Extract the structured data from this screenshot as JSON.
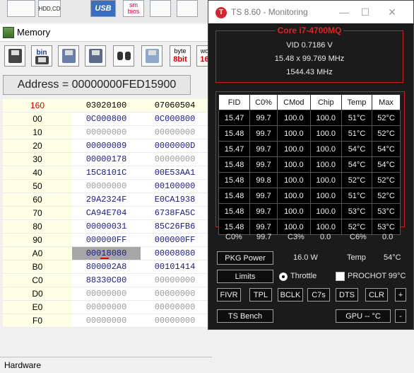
{
  "background_toolbar": {
    "items": [
      "HDD,CD",
      "USB",
      "sm bios"
    ]
  },
  "memory_window": {
    "title": "Memory",
    "toolbar": {
      "bin_label": "bin",
      "byte_label_top": "byte",
      "byte_label_bottom": "8bit",
      "word_label_top": "wo",
      "word_label_bottom": "16"
    },
    "address_display": "Address = 00000000FED15900",
    "grid": {
      "header": [
        "160",
        "03020100",
        "07060504"
      ],
      "rows": [
        {
          "label": "00",
          "c1": "0C000800",
          "c2": "0C000800"
        },
        {
          "label": "10",
          "c1": "00000000",
          "c2": "00000000"
        },
        {
          "label": "20",
          "c1": "00000009",
          "c2": "0000000D"
        },
        {
          "label": "30",
          "c1": "00000178",
          "c2": "00000000"
        },
        {
          "label": "40",
          "c1": "15C8101C",
          "c2": "00E53AA1"
        },
        {
          "label": "50",
          "c1": "00000000",
          "c2": "00100000"
        },
        {
          "label": "60",
          "c1": "29A2324F",
          "c2": "E0CA1938"
        },
        {
          "label": "70",
          "c1": "CA94E704",
          "c2": "6738FA5C"
        },
        {
          "label": "80",
          "c1": "00000031",
          "c2": "85C26FB6"
        },
        {
          "label": "90",
          "c1": "000000FF",
          "c2": "000000FF"
        },
        {
          "label": "A0",
          "c1": "00018080",
          "c2": "00008080"
        },
        {
          "label": "B0",
          "c1": "800002A8",
          "c2": "00101414"
        },
        {
          "label": "C0",
          "c1": "88330C00",
          "c2": "00000000"
        },
        {
          "label": "D0",
          "c1": "00000000",
          "c2": "00000000"
        },
        {
          "label": "E0",
          "c1": "00000000",
          "c2": "00000000"
        },
        {
          "label": "F0",
          "c1": "00000000",
          "c2": "00000000"
        }
      ]
    },
    "status": "Hardware"
  },
  "ts_window": {
    "title": "TS 8.60 - Monitoring",
    "logo_letter": "T",
    "cpu": {
      "name": "Core i7-4700MQ",
      "vid": "VID  0.7186 V",
      "multiplier": "15.48 x 99.769 MHz",
      "frequency": "1544.43 MHz"
    },
    "table": {
      "headers": [
        "FID",
        "C0%",
        "CMod",
        "Chip",
        "Temp",
        "Max"
      ],
      "rows": [
        [
          "15.47",
          "99.7",
          "100.0",
          "100.0",
          "51°C",
          "52°C"
        ],
        [
          "15.48",
          "99.7",
          "100.0",
          "100.0",
          "51°C",
          "52°C"
        ],
        [
          "15.47",
          "99.7",
          "100.0",
          "100.0",
          "54°C",
          "54°C"
        ],
        [
          "15.48",
          "99.7",
          "100.0",
          "100.0",
          "54°C",
          "54°C"
        ],
        [
          "15.48",
          "99.8",
          "100.0",
          "100.0",
          "52°C",
          "52°C"
        ],
        [
          "15.48",
          "99.7",
          "100.0",
          "100.0",
          "51°C",
          "52°C"
        ],
        [
          "15.48",
          "99.7",
          "100.0",
          "100.0",
          "53°C",
          "53°C"
        ],
        [
          "15.48",
          "99.7",
          "100.0",
          "100.0",
          "52°C",
          "53°C"
        ]
      ]
    },
    "summary": {
      "c0_label": "C0%",
      "c0_value": "99.7",
      "c3_label": "C3%",
      "c3_value": "0.0",
      "c6_label": "C6%",
      "c6_value": "0.0"
    },
    "pkg_power": {
      "button": "PKG Power",
      "value": "16.0 W",
      "temp_label": "Temp",
      "temp_value": "54°C"
    },
    "limits": {
      "button": "Limits",
      "throttle_label": "Throttle",
      "prochot_label": "PROCHOT 99°C"
    },
    "buttons_row": [
      "FIVR",
      "TPL",
      "BCLK",
      "C7s",
      "DTS",
      "CLR",
      "+"
    ],
    "bottom": {
      "bench": "TS Bench",
      "gpu": "GPU --  °C",
      "minus": "-"
    },
    "window_controls": {
      "minimize": "—",
      "maximize": "☐",
      "close": "✕"
    }
  }
}
